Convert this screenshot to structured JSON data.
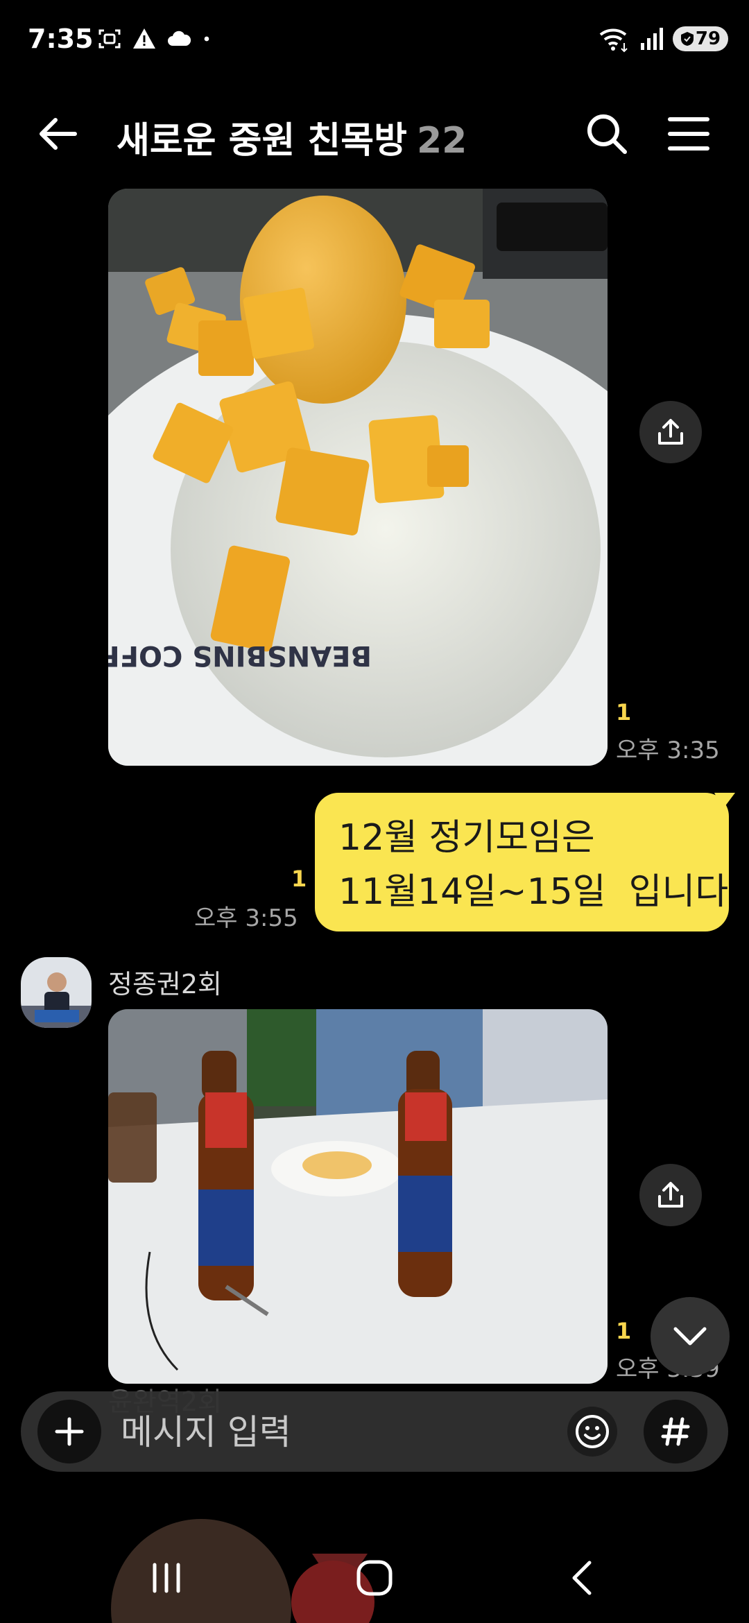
{
  "status_bar": {
    "time": "7:35",
    "left_icons": [
      "screenshot-icon",
      "warning-icon",
      "cloud-icon",
      "dot-icon"
    ],
    "right_icons": [
      "wifi-icon",
      "signal-icon"
    ],
    "battery": "79"
  },
  "header": {
    "title": "새로운 중원 친목방",
    "member_count": "22"
  },
  "messages": [
    {
      "type": "photo",
      "description_icon": "photo-mango-bingsu",
      "unread": "1",
      "time": "오후 3:35"
    },
    {
      "type": "text",
      "from_me": true,
      "lines": [
        "12월 정기모임은",
        "11월14일~15일  입니다"
      ],
      "unread": "1",
      "time": "오후 3:55"
    },
    {
      "type": "photo",
      "sender": "정종권2회",
      "unread": "1",
      "time": "오후 3:59"
    }
  ],
  "ghost_sender": "윤완역2회",
  "input": {
    "placeholder": "메시지 입력"
  },
  "colors": {
    "bubble_me": "#fae551",
    "unread": "#f8d64e",
    "background": "#000000"
  }
}
